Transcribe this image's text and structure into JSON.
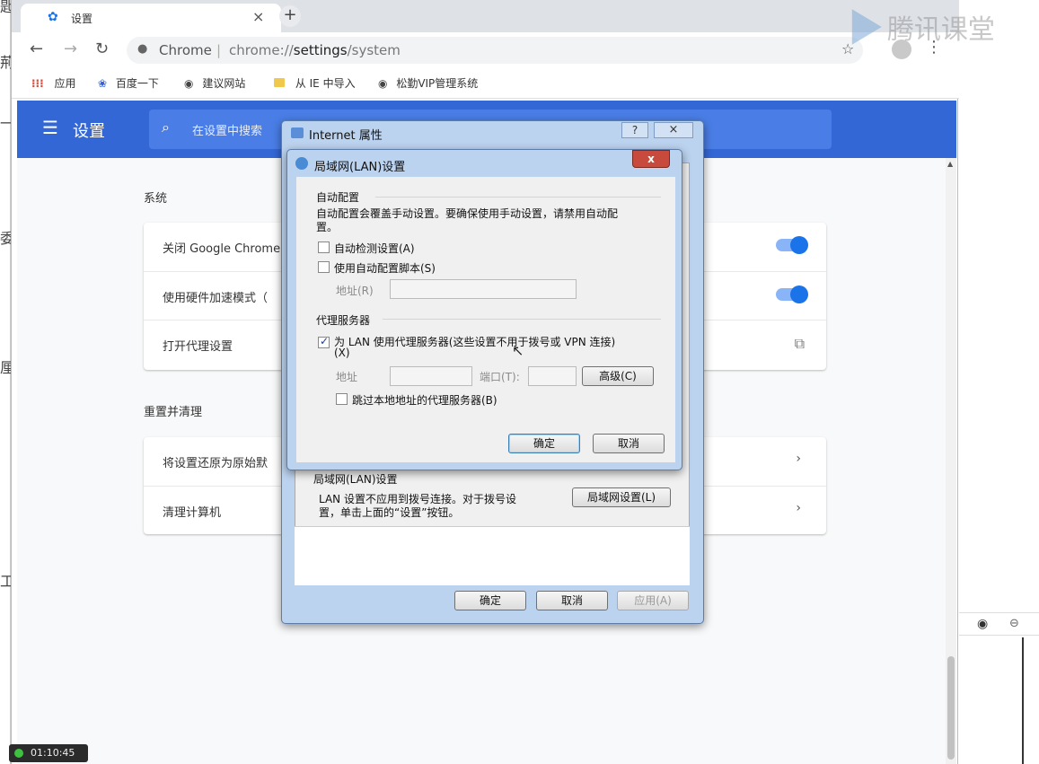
{
  "left_strip_glyphs": [
    "匙",
    "荊",
    "一",
    "委",
    "厘",
    "工"
  ],
  "watermark": "腾讯课堂",
  "browser": {
    "tab_title": "设置",
    "url_site": "Chrome",
    "url_sep": "|",
    "url_scheme": "chrome://",
    "url_host": "settings",
    "url_path": "/system",
    "bookmarks": [
      {
        "label": "应用",
        "icon": "apps-grid-icon"
      },
      {
        "label": "百度一下",
        "icon": "baidu-paw-icon"
      },
      {
        "label": "建议网站",
        "icon": "globe-icon"
      },
      {
        "label": "从 IE 中导入",
        "icon": "folder-icon"
      },
      {
        "label": "松勤VIP管理系统",
        "icon": "globe-icon"
      }
    ]
  },
  "settings": {
    "title": "设置",
    "search_placeholder": "在设置中搜索",
    "system_section": "系统",
    "system_rows": [
      {
        "label": "关闭 Google Chrome"
      },
      {
        "label": "使用硬件加速模式（"
      },
      {
        "label": "打开代理设置"
      }
    ],
    "reset_section": "重置并清理",
    "reset_rows": [
      {
        "label": "将设置还原为原始默"
      },
      {
        "label": "清理计算机"
      }
    ]
  },
  "internet_props": {
    "title": "Internet 属性",
    "help": "?",
    "close": "×",
    "lan_group": "局域网(LAN)设置",
    "lan_desc_1": "LAN 设置不应用到拨号连接。对于拨号设",
    "lan_desc_2": "置，单击上面的“设置”按钮。",
    "lan_button": "局域网设置(L)",
    "ok": "确定",
    "cancel": "取消",
    "apply": "应用(A)"
  },
  "lan_dialog": {
    "title": "局域网(LAN)设置",
    "close": "x",
    "auto_group": "自动配置",
    "auto_desc_1": "自动配置会覆盖手动设置。要确保使用手动设置，请禁用自动配",
    "auto_desc_2": "置。",
    "auto_detect": "自动检测设置(A)",
    "use_script": "使用自动配置脚本(S)",
    "address_label": "地址(R)",
    "proxy_group": "代理服务器",
    "use_proxy_1": "为 LAN 使用代理服务器(这些设置不用于拨号或 VPN 连接)",
    "use_proxy_2": "(X)",
    "proxy_address": "地址",
    "port_label": "端口(T):",
    "advanced": "高级(C)",
    "bypass_local": "跳过本地地址的代理服务器(B)",
    "ok": "确定",
    "cancel": "取消"
  },
  "timer": "01:10:45"
}
